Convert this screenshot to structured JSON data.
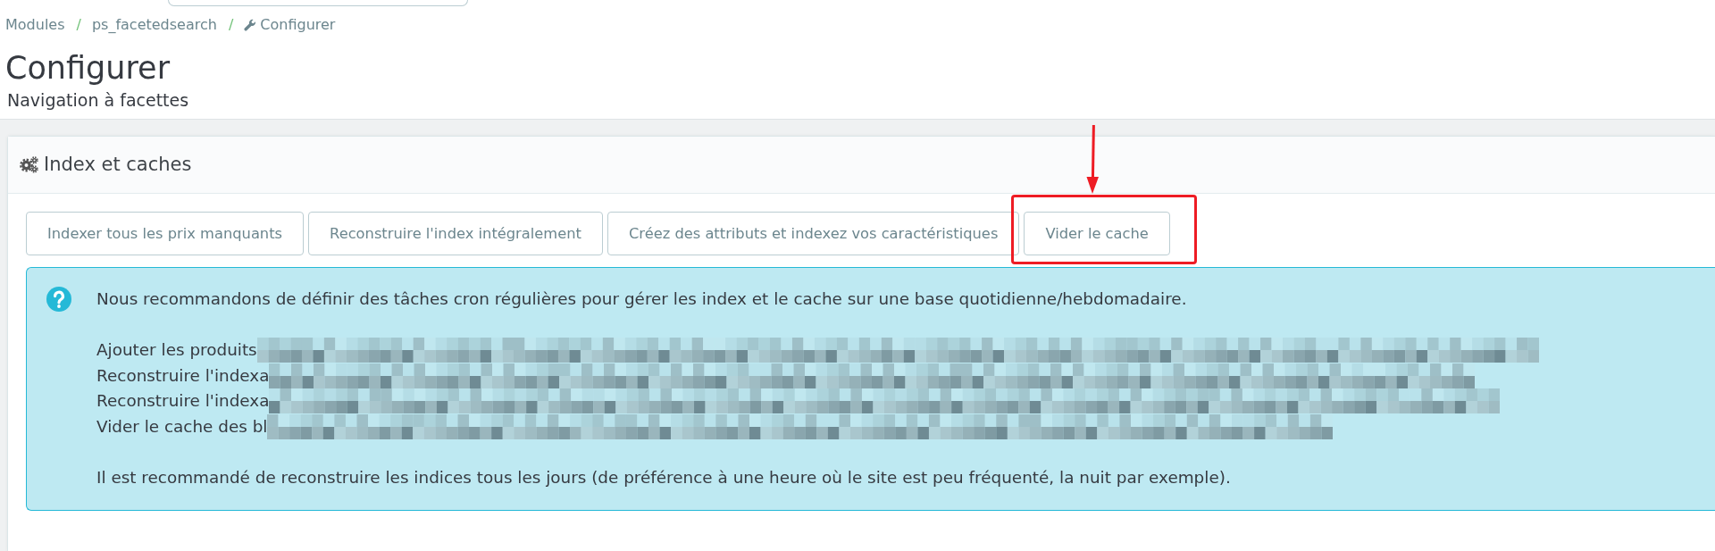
{
  "breadcrumb": [
    {
      "label": "Modules"
    },
    {
      "separator": "/",
      "label": "ps_facetedsearch"
    },
    {
      "separator": "/",
      "label": "Configurer"
    }
  ],
  "page_title": "Configurer",
  "page_subtitle": "Navigation à facettes",
  "panel": {
    "title": "Index et caches",
    "buttons": [
      {
        "label": "Indexer tous les prix manquants",
        "highlighted": false
      },
      {
        "label": "Reconstruire l'index intégralement",
        "highlighted": false
      },
      {
        "label": "Créez des attributs et indexez vos caractéristiques",
        "highlighted": false
      },
      {
        "label": "Vider le cache",
        "highlighted": true
      }
    ],
    "info": {
      "paragraphs": [
        {
          "lines": [
            {
              "text": "Nous recommandons de définir des tâches cron régulières pour gérer les index et le cache sur une base quotidienne/hebdomadaire.",
              "redacted": false
            }
          ]
        },
        {
          "lines": [
            {
              "text": "Ajouter les produits",
              "redacted": true
            },
            {
              "text": "Reconstruire l'indexa",
              "redacted": true
            },
            {
              "text": "Reconstruire l'indexa",
              "redacted": true
            },
            {
              "text": "Vider le cache des bl",
              "redacted": true
            }
          ]
        },
        {
          "lines": [
            {
              "text": "Il est recommandé de reconstruire les indices tous les jours (de préférence à une heure où le site est peu fréquenté, la nuit par exemple).",
              "redacted": false
            }
          ]
        }
      ]
    }
  }
}
